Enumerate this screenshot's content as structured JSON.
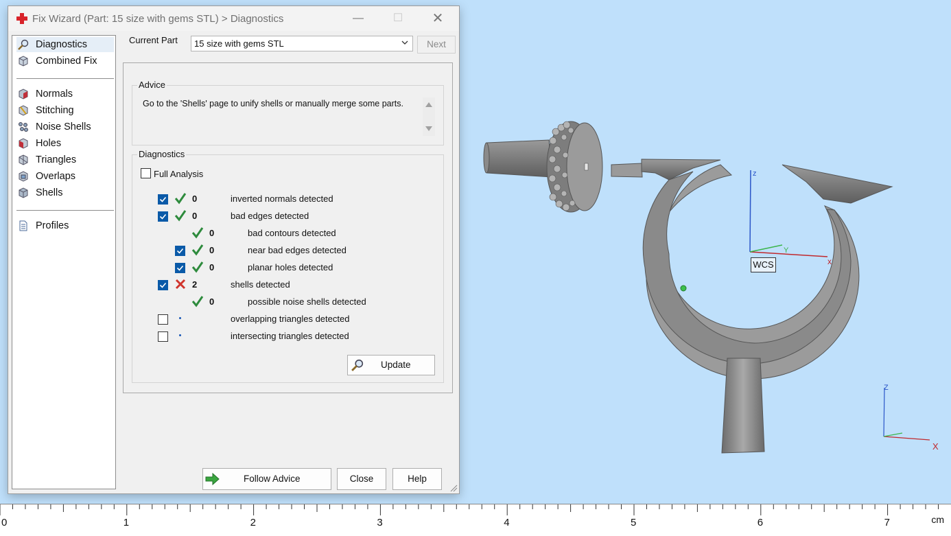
{
  "window": {
    "title": "Fix Wizard (Part: 15 size with gems STL) > Diagnostics",
    "minimize": "—",
    "maximize": "☐",
    "close": "✕"
  },
  "nav": {
    "items": [
      {
        "label": "Diagnostics",
        "icon": "magnifier-icon"
      },
      {
        "label": "Combined Fix",
        "icon": "cube-icon"
      },
      {
        "label": "Normals",
        "icon": "normals-icon"
      },
      {
        "label": "Stitching",
        "icon": "stitching-icon"
      },
      {
        "label": "Noise Shells",
        "icon": "noise-shells-icon"
      },
      {
        "label": "Holes",
        "icon": "holes-icon"
      },
      {
        "label": "Triangles",
        "icon": "triangles-icon"
      },
      {
        "label": "Overlaps",
        "icon": "overlaps-icon"
      },
      {
        "label": "Shells",
        "icon": "shells-icon"
      },
      {
        "label": "Profiles",
        "icon": "document-icon"
      }
    ]
  },
  "header": {
    "current_part_label": "Current Part",
    "current_part_value": "15 size with gems STL",
    "next_label": "Next"
  },
  "advice": {
    "title": "Advice",
    "text": "Go to the 'Shells' page to unify shells or manually merge some parts."
  },
  "diagnostics": {
    "title": "Diagnostics",
    "full_analysis_label": "Full Analysis",
    "rows": [
      {
        "checked": true,
        "status": "ok",
        "count": "0",
        "text": "inverted normals detected"
      },
      {
        "checked": true,
        "status": "ok",
        "count": "0",
        "text": "bad edges detected"
      },
      {
        "checked": null,
        "status": "ok",
        "count": "0",
        "text": "bad contours detected"
      },
      {
        "checked": true,
        "status": "ok",
        "count": "0",
        "text": "near bad edges detected"
      },
      {
        "checked": true,
        "status": "ok",
        "count": "0",
        "text": "planar holes detected"
      },
      {
        "checked": true,
        "status": "error",
        "count": "2",
        "text": "shells detected"
      },
      {
        "checked": null,
        "status": "ok",
        "count": "0",
        "text": "possible noise shells detected"
      },
      {
        "checked": false,
        "status": "none",
        "count": "",
        "text": "overlapping triangles detected"
      },
      {
        "checked": false,
        "status": "none",
        "count": "",
        "text": "intersecting triangles detected"
      }
    ],
    "update_label": "Update"
  },
  "footer": {
    "follow_advice_label": "Follow Advice",
    "close_label": "Close",
    "help_label": "Help"
  },
  "viewport": {
    "wcs_label": "WCS",
    "axis_z": "z",
    "axis_y": "Y",
    "axis_x": "x",
    "mini_axis_z": "Z",
    "mini_axis_x": "X"
  },
  "ruler": {
    "labels": [
      "0",
      "1",
      "2",
      "3",
      "4",
      "5",
      "6",
      "7"
    ],
    "unit": "cm"
  },
  "colors": {
    "viewport_bg": "#bfe0fb",
    "check_green": "#2e8b3d",
    "error_red": "#d0342c",
    "checkbox_blue": "#0a5aa8"
  }
}
